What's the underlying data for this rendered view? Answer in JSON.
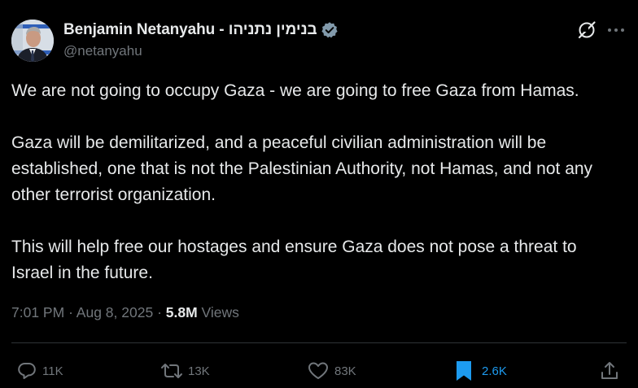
{
  "author": {
    "name": "Benjamin Netanyahu - בנימין נתניהו",
    "handle": "@netanyahu",
    "verified": true,
    "verified_color": "#829aab"
  },
  "header_icons": [
    "grok-icon",
    "more-icon"
  ],
  "tweet": {
    "paragraphs": [
      "We are not going to occupy Gaza - we are going to free Gaza from Hamas.",
      "Gaza will be demilitarized, and a peaceful civilian administration will be established, one that is not the Palestinian Authority, not Hamas, and not any other terrorist organization.",
      "This will help free our hostages and ensure Gaza does not pose a threat to Israel in the future."
    ]
  },
  "meta": {
    "time": "7:01 PM",
    "separator": "·",
    "date": "Aug 8, 2025",
    "views_count": "5.8M",
    "views_label": "Views"
  },
  "actions": {
    "replies": "11K",
    "reposts": "13K",
    "likes": "83K",
    "bookmarks": "2.6K",
    "bookmarked": true
  },
  "colors": {
    "background": "#000000",
    "text": "#e7e9ea",
    "secondary": "#71767b",
    "accent": "#1d9bf0",
    "divider": "#2f3336"
  }
}
